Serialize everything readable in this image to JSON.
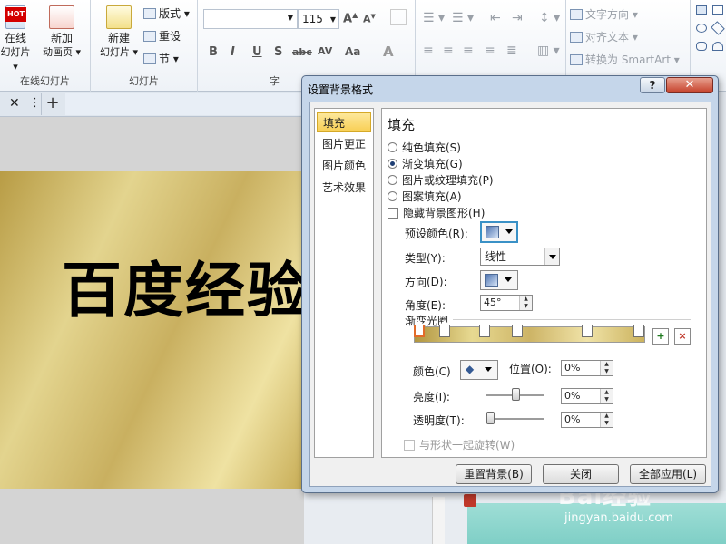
{
  "ribbon": {
    "hot_badge": "HOT",
    "online_slide": {
      "line1": "在线",
      "line2": "幻灯片 ▾",
      "group_label": "在线幻灯片"
    },
    "new_anim_page": {
      "line1": "新加",
      "line2": "动画页 ▾"
    },
    "new_slide": {
      "line1": "新建",
      "line2": "幻灯片 ▾"
    },
    "layout": "版式 ▾",
    "reset": "重设",
    "section": "节 ▾",
    "slides_group_label": "幻灯片",
    "font_size": "115",
    "font_group_label_partial": "字",
    "text_direction": "文字方向 ▾",
    "align_text": "对齐文本 ▾",
    "smartart": "转换为 SmartArt ▾",
    "format_buttons": [
      "B",
      "I",
      "U",
      "S",
      "abc",
      "AV",
      "Aa",
      "A"
    ]
  },
  "slide": {
    "title": "百度经验"
  },
  "dialog": {
    "title": "设置背景格式",
    "help": "?",
    "close": "✕",
    "nav": [
      "填充",
      "图片更正",
      "图片颜色",
      "艺术效果"
    ],
    "section_title": "填充",
    "fill_options": [
      {
        "label": "纯色填充(S)",
        "checked": false
      },
      {
        "label": "渐变填充(G)",
        "checked": true
      },
      {
        "label": "图片或纹理填充(P)",
        "checked": false
      },
      {
        "label": "图案填充(A)",
        "checked": false
      }
    ],
    "hide_bg_graphics": "隐藏背景图形(H)",
    "preset_color_label": "预设颜色(R):",
    "type_label": "类型(Y):",
    "type_value": "线性",
    "direction_label": "方向(D):",
    "angle_label": "角度(E):",
    "angle_value": "45°",
    "gradient_stops_label": "渐变光圈",
    "add_stop": "+",
    "remove_stop": "×",
    "color_label": "颜色(C)",
    "position_label": "位置(O):",
    "position_value": "0%",
    "brightness_label": "亮度(I):",
    "brightness_value": "0%",
    "brightness_level": 0.5,
    "transparency_label": "透明度(T):",
    "transparency_value": "0%",
    "transparency_level": 0,
    "rotate_with_shape": "与形状一起旋转(W)",
    "reset_bg": "重置背景(B)",
    "close_btn": "关闭",
    "apply_all": "全部应用(L)"
  },
  "watermark": {
    "brand": "Bai经验",
    "url": "jingyan.baidu.com"
  }
}
